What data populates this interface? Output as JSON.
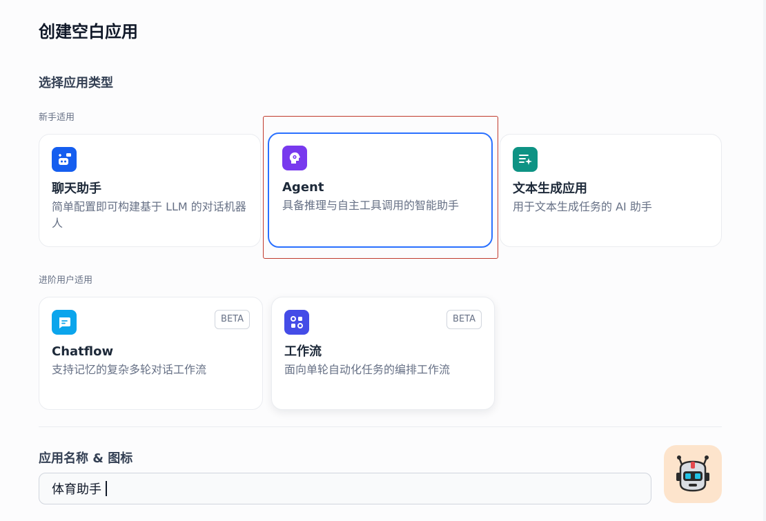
{
  "page_title": "创建空白应用",
  "section_title": "选择应用类型",
  "groups": [
    {
      "label": "新手适用"
    },
    {
      "label": "进阶用户适用"
    }
  ],
  "cards": {
    "chat": {
      "title": "聊天助手",
      "desc": "简单配置即可构建基于 LLM 的对话机器人",
      "icon": "chat-robot-icon",
      "color": "#155eef"
    },
    "agent": {
      "title": "Agent",
      "desc": "具备推理与自主工具调用的智能助手",
      "icon": "agent-brain-icon",
      "color": "#7839ee",
      "selected": true
    },
    "completion": {
      "title": "文本生成应用",
      "desc": "用于文本生成任务的 AI 助手",
      "icon": "text-generation-icon",
      "color": "#0e9384"
    },
    "chatflow": {
      "title": "Chatflow",
      "desc": "支持记忆的复杂多轮对话工作流",
      "badge": "BETA",
      "icon": "chatflow-icon",
      "color": "#0ba5ec"
    },
    "workflow": {
      "title": "工作流",
      "desc": "面向单轮自动化任务的编排工作流",
      "badge": "BETA",
      "icon": "workflow-icon",
      "color": "#444ce7"
    }
  },
  "app_name": {
    "label": "应用名称 & 图标",
    "value": "体育助手",
    "avatar_icon": "robot-avatar-icon",
    "avatar_bg": "#fde4cc"
  }
}
